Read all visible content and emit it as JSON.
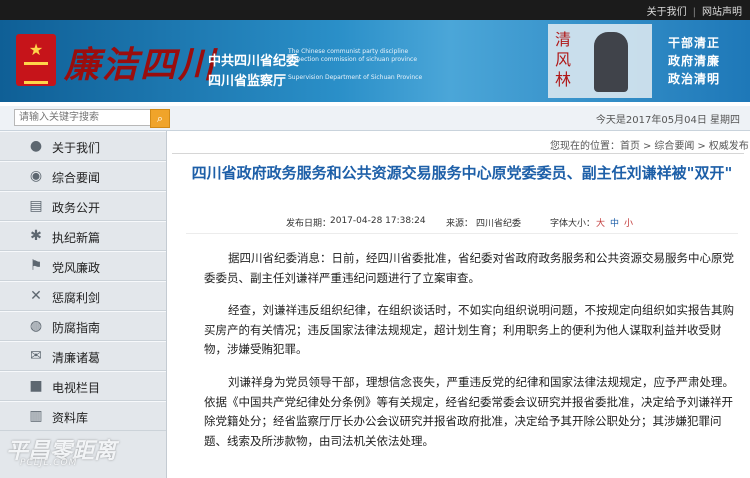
{
  "topbar": {
    "links": [
      "关于我们",
      "网站声明"
    ]
  },
  "banner": {
    "logo_text": "廉洁四川",
    "org_cn_1": "中共四川省纪委",
    "org_en_1": "The Chinese communist party discipline inspection commission of sichuan province",
    "org_cn_2": "四川省监察厅",
    "org_en_2": "Supervision Department of Sichuan Province",
    "motto_vertical": "清风林",
    "statue_caption": "",
    "slogans": [
      "干部清正",
      "政府清廉",
      "政治清明"
    ]
  },
  "search": {
    "placeholder": "请输入关键字搜索",
    "button_icon": "search-icon"
  },
  "date": {
    "text": "今天是2017年05月04日  星期四"
  },
  "sidebar": {
    "items": [
      {
        "label": "关于我们",
        "icon": "user-icon"
      },
      {
        "label": "综合要闻",
        "icon": "eye-icon"
      },
      {
        "label": "政务公开",
        "icon": "folder-icon"
      },
      {
        "label": "执纪新篇",
        "icon": "star-icon"
      },
      {
        "label": "党风廉政",
        "icon": "flag-icon"
      },
      {
        "label": "惩腐利剑",
        "icon": "sword-icon"
      },
      {
        "label": "防腐指南",
        "icon": "globe-icon"
      },
      {
        "label": "清廉诸葛",
        "icon": "chat-icon"
      },
      {
        "label": "电视栏目",
        "icon": "tv-icon"
      },
      {
        "label": "资料库",
        "icon": "archive-icon"
      }
    ]
  },
  "watermark": {
    "main": "平昌零距离",
    "sub": "PCLJL.COM"
  },
  "breadcrumb": {
    "prefix": "您现在的位置：",
    "items": [
      "首页",
      "综合要闻",
      "权威发布"
    ],
    "sep": ">"
  },
  "article": {
    "title": "四川省政府政务服务和公共资源交易服务中心原党委委员、副主任刘谦祥被\"双开\"",
    "pub_label": "发布日期：",
    "pub_value": "2017-04-28 17:38:24",
    "src_label": "来源：",
    "src_value": "四川省纪委",
    "size_label": "字体大小：",
    "sizes": [
      "大",
      "中",
      "小"
    ],
    "paragraphs": [
      "据四川省纪委消息：日前，经四川省委批准，省纪委对省政府政务服务和公共资源交易服务中心原党委委员、副主任刘谦祥严重违纪问题进行了立案审查。",
      "经查，刘谦祥违反组织纪律，在组织谈话时，不如实向组织说明问题，不按规定向组织如实报告其购买房产的有关情况；违反国家法律法规规定，超计划生育；利用职务上的便利为他人谋取利益并收受财物，涉嫌受贿犯罪。",
      "刘谦祥身为党员领导干部，理想信念丧失，严重违反党的纪律和国家法律法规规定，应予严肃处理。依据《中国共产党纪律处分条例》等有关规定，经省纪委常委会议研究并报省委批准，决定给予刘谦祥开除党籍处分；经省监察厅厅长办公会议研究并报省政府批准，决定给予其开除公职处分；其涉嫌犯罪问题、线索及所涉款物，由司法机关依法处理。"
    ]
  },
  "colors": {
    "title": "#1d5fa8",
    "banner": "#2a8fc8",
    "seal": "#c6141a",
    "search_button": "#f0a42a"
  }
}
